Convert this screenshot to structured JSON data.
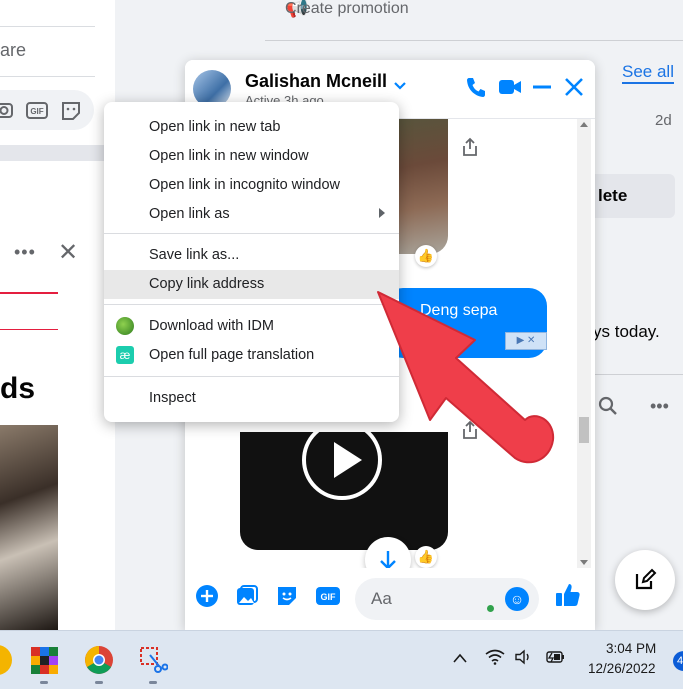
{
  "left_panel": {
    "share_text": "are",
    "comment_icons": [
      "camera-icon",
      "gif-icon",
      "sticker-icon"
    ],
    "gif_label": "GIF",
    "post_heading_fragment": "ds"
  },
  "feed": {
    "create_promotion": "Create promotion",
    "see_all": "See all",
    "time": "2d",
    "delete_label": "lete",
    "text_fragment": "ys today."
  },
  "chat": {
    "name": "Galishan Mcneill",
    "status": "Active 3h ago",
    "message_text": "Deng sepa",
    "input_placeholder": "Aa",
    "ad_badge": "▶ ✕",
    "colors": {
      "accent": "#0084ff",
      "online": "#31a24c"
    }
  },
  "context_menu": {
    "items": [
      {
        "label": "Open link in new tab"
      },
      {
        "label": "Open link in new window"
      },
      {
        "label": "Open link in incognito window"
      },
      {
        "label": "Open link as"
      },
      {
        "label": "Save link as..."
      },
      {
        "label": "Copy link address"
      },
      {
        "label": "Download with IDM"
      },
      {
        "label": "Open full page translation"
      },
      {
        "label": "Inspect"
      }
    ],
    "highlighted_item": "Copy link address"
  },
  "annotation": {
    "color": "#ef3e4a"
  },
  "taskbar": {
    "time": "3:04 PM",
    "date": "12/26/2022",
    "notification_count": "4",
    "tray_icons": [
      "chevron-up-icon",
      "wifi-icon",
      "speaker-icon",
      "battery-icon"
    ]
  }
}
